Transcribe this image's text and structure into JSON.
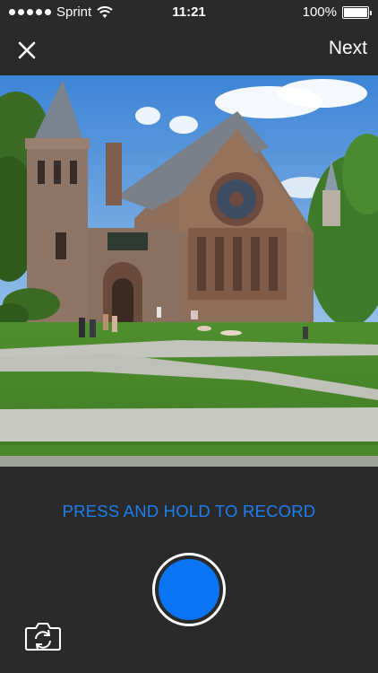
{
  "status_bar": {
    "carrier": "Sprint",
    "time": "11:21",
    "battery": "100%",
    "battery_level": 1.0
  },
  "nav": {
    "close_icon": "close-icon",
    "next_label": "Next"
  },
  "preview": {
    "description_icon": "camera-preview"
  },
  "record": {
    "hint": "PRESS AND HOLD TO RECORD",
    "button_color": "#0a75f2",
    "hint_color": "#1c7ff0"
  },
  "camera_switch": {
    "icon": "camera-switch-icon"
  }
}
